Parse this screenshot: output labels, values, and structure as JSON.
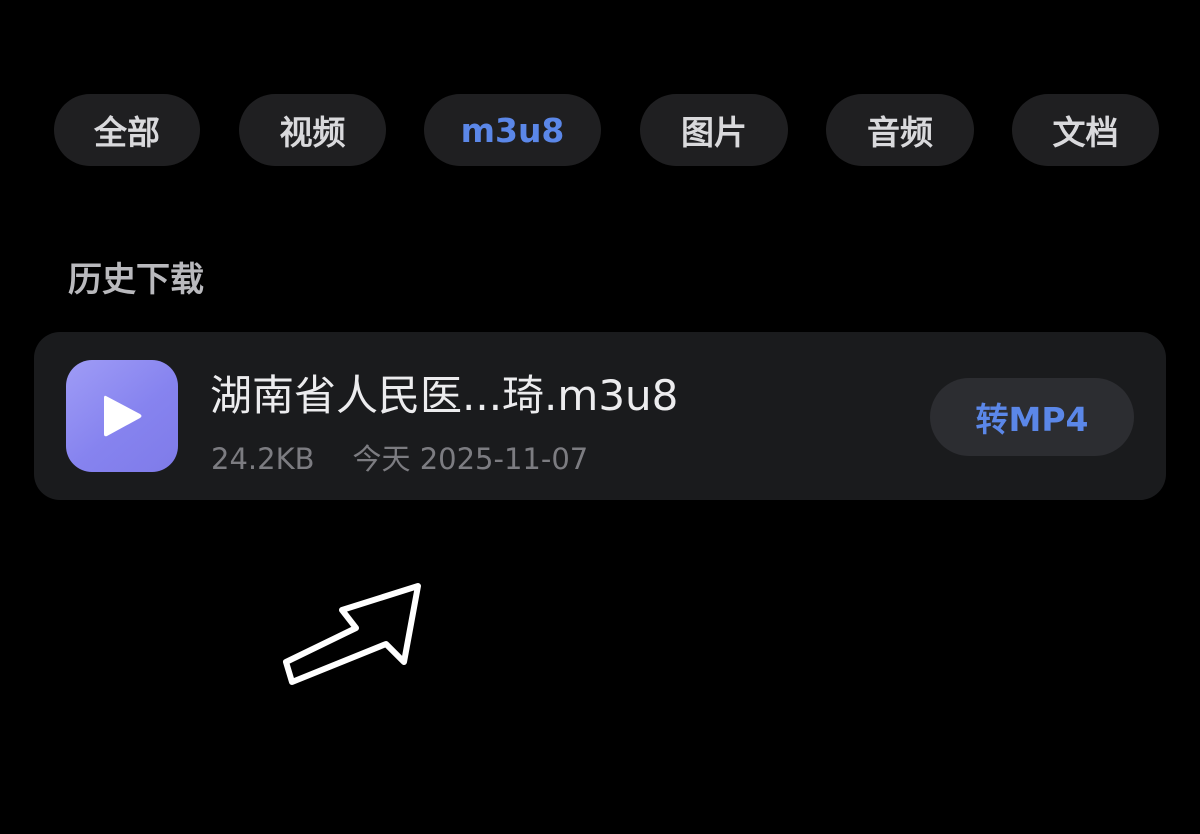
{
  "tabs": [
    {
      "label": "全部",
      "active": false
    },
    {
      "label": "视频",
      "active": false
    },
    {
      "label": "m3u8",
      "active": true
    },
    {
      "label": "图片",
      "active": false
    },
    {
      "label": "音频",
      "active": false
    },
    {
      "label": "文档",
      "active": false
    }
  ],
  "section": {
    "title": "历史下载"
  },
  "download_item": {
    "icon": "play-icon",
    "file_name": "湖南省人民医...琦.m3u8",
    "size": "24.2KB",
    "date": "今天 2025-11-07",
    "convert_label": "转MP4"
  },
  "annotation": {
    "icon": "hand-drawn-arrow-icon"
  },
  "colors": {
    "background": "#000000",
    "tab_background": "#1f1f21",
    "card_background": "#1a1b1d",
    "accent": "#5b87e8",
    "icon_gradient_start": "#9f9cf6",
    "icon_gradient_end": "#7f7be9"
  }
}
